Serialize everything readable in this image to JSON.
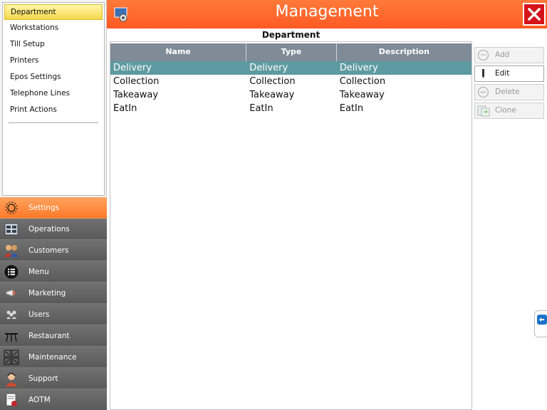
{
  "header": {
    "title": "Management"
  },
  "left_menu": {
    "items": [
      {
        "label": "Department",
        "selected": true
      },
      {
        "label": "Workstations"
      },
      {
        "label": "Till Setup"
      },
      {
        "label": "Printers"
      },
      {
        "label": "Epos Settings"
      },
      {
        "label": "Telephone Lines"
      },
      {
        "label": "Print Actions"
      }
    ]
  },
  "nav": {
    "items": [
      {
        "label": "Settings",
        "icon": "gear-icon",
        "active": true
      },
      {
        "label": "Operations",
        "icon": "operations-icon"
      },
      {
        "label": "Customers",
        "icon": "customers-icon"
      },
      {
        "label": "Menu",
        "icon": "menu-list-icon"
      },
      {
        "label": "Marketing",
        "icon": "megaphone-icon"
      },
      {
        "label": "Users",
        "icon": "users-icon"
      },
      {
        "label": "Restaurant",
        "icon": "restaurant-table-icon"
      },
      {
        "label": "Maintenance",
        "icon": "maintenance-icon"
      },
      {
        "label": "Support",
        "icon": "support-agent-icon"
      },
      {
        "label": "AOTM",
        "icon": "aotm-icon"
      }
    ]
  },
  "grid": {
    "title": "Department",
    "columns": [
      "Name",
      "Type",
      "Description"
    ],
    "rows": [
      [
        "Delivery",
        "Delivery",
        "Delivery"
      ],
      [
        "Collection",
        "Collection",
        "Collection"
      ],
      [
        "Takeaway",
        "Takeaway",
        "Takeaway"
      ],
      [
        "EatIn",
        "EatIn",
        "EatIn"
      ]
    ],
    "selected_row": 0
  },
  "actions": {
    "add": "Add",
    "edit": "Edit",
    "delete": "Delete",
    "clone": "Clone"
  },
  "colors": {
    "header_orange": "#ff6a2d",
    "active_nav": "#ff8b3e",
    "selected_row": "#5e9aa1",
    "close_red": "#d4141a"
  }
}
